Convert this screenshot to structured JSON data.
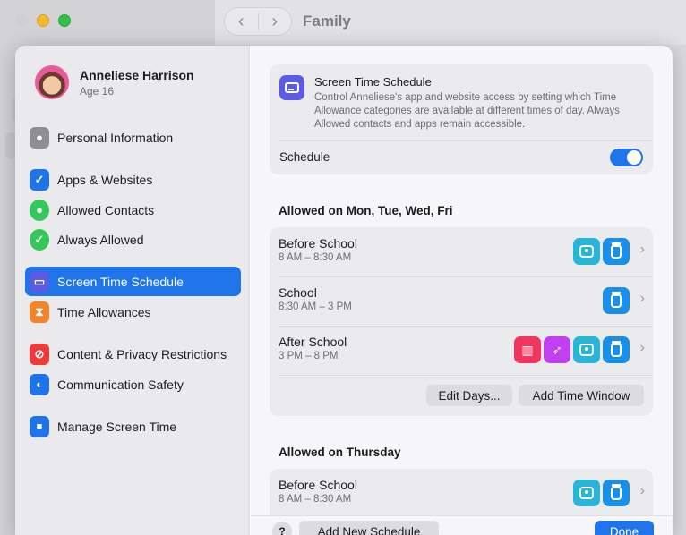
{
  "window": {
    "title": "Family",
    "back_glyph": "‹",
    "forward_glyph": "›"
  },
  "user": {
    "name": "Anneliese Harrison",
    "age": "Age 16"
  },
  "sidebar": {
    "items": [
      {
        "label": "Personal Information",
        "icon": "person-icon",
        "color": "#8e8e93",
        "glyph": "●"
      },
      {
        "label": "Apps & Websites",
        "icon": "apps-websites-icon",
        "color": "#1e74e8",
        "glyph": "✓"
      },
      {
        "label": "Allowed Contacts",
        "icon": "contacts-icon",
        "color": "#34c759",
        "glyph": "●"
      },
      {
        "label": "Always Allowed",
        "icon": "checkmark-badge-icon",
        "color": "#34c759",
        "glyph": "✓"
      },
      {
        "label": "Screen Time Schedule",
        "icon": "calendar-icon",
        "color": "#5a5ce6",
        "glyph": "▭"
      },
      {
        "label": "Time Allowances",
        "icon": "hourglass-icon",
        "color": "#f5852b",
        "glyph": "⧗"
      },
      {
        "label": "Content & Privacy Restrictions",
        "icon": "restriction-icon",
        "color": "#f03a3a",
        "glyph": "⊘"
      },
      {
        "label": "Communication Safety",
        "icon": "chat-bubbles-icon",
        "color": "#1e74e8",
        "glyph": "◐"
      },
      {
        "label": "Manage Screen Time",
        "icon": "lock-icon",
        "color": "#1e74e8",
        "glyph": "🔒"
      }
    ]
  },
  "header_card": {
    "title": "Screen Time Schedule",
    "description": "Control Anneliese's app and website access by setting which Time Allowance categories are available at different times of day. Always Allowed contacts and apps remain accessible.",
    "schedule_label": "Schedule",
    "schedule_on": true
  },
  "sections": [
    {
      "title": "Allowed on Mon, Tue, Wed, Fri",
      "rows": [
        {
          "name": "Before School",
          "time": "8 AM – 8:30 AM"
        },
        {
          "name": "School",
          "time": "8:30 AM – 3 PM"
        },
        {
          "name": "After School",
          "time": "3 PM – 8 PM"
        }
      ],
      "edit_days_label": "Edit Days...",
      "add_time_window_label": "Add Time Window"
    },
    {
      "title": "Allowed on Thursday",
      "rows": [
        {
          "name": "Before School",
          "time": "8 AM – 8:30 AM"
        }
      ]
    }
  ],
  "footer": {
    "help_label": "?",
    "add_new_schedule_label": "Add New Schedule",
    "done_label": "Done"
  },
  "colors": {
    "accent": "#1e74e8",
    "contacts_icon": "#27b5d9",
    "jar_icon": "#1a8fe8",
    "popcorn_icon": "#f0355e",
    "rocket_icon": "#c13ff0"
  },
  "chevron": "›"
}
